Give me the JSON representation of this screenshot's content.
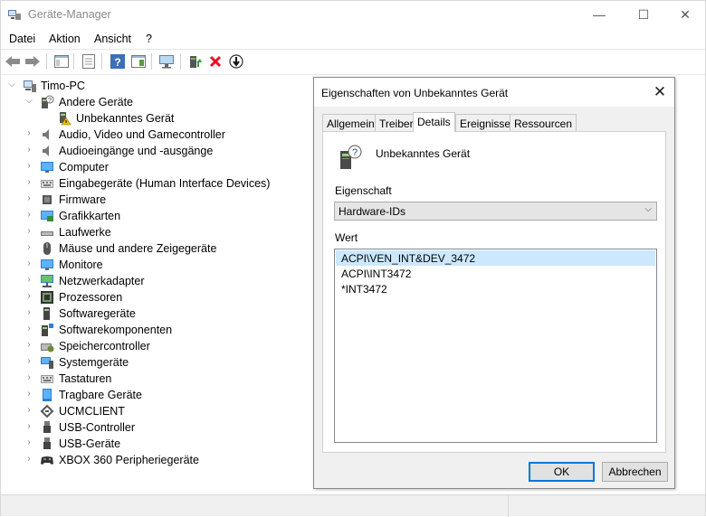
{
  "window": {
    "title": "Geräte-Manager",
    "minimize": "—",
    "maximize": "☐",
    "close": "✕"
  },
  "menu": [
    "Datei",
    "Aktion",
    "Ansicht",
    "?"
  ],
  "toolbar": {
    "icons": [
      "back-arrow-icon",
      "forward-arrow-icon",
      "show-hide-tree-icon",
      "properties-icon",
      "help-icon",
      "action-pane-icon",
      "scan-hardware-icon",
      "update-driver-icon",
      "uninstall-icon",
      "disable-device-icon"
    ],
    "uninstall_color": "#e81123"
  },
  "tree": {
    "root": "Timo-PC",
    "expanded_group": "Andere Geräte",
    "expanded_child": "Unbekanntes Gerät",
    "categories": [
      "Audio, Video und Gamecontroller",
      "Audioeingänge und -ausgänge",
      "Computer",
      "Eingabegeräte (Human Interface Devices)",
      "Firmware",
      "Grafikkarten",
      "Laufwerke",
      "Mäuse und andere Zeigegeräte",
      "Monitore",
      "Netzwerkadapter",
      "Prozessoren",
      "Softwaregeräte",
      "Softwarekomponenten",
      "Speichercontroller",
      "Systemgeräte",
      "Tastaturen",
      "Tragbare Geräte",
      "UCMCLIENT",
      "USB-Controller",
      "USB-Geräte",
      "XBOX 360 Peripheriegeräte"
    ]
  },
  "dialog": {
    "title": "Eigenschaften von Unbekanntes Gerät",
    "close": "✕",
    "tabs": [
      "Allgemein",
      "Treiber",
      "Details",
      "Ereignisse",
      "Ressourcen"
    ],
    "active_tab": "Details",
    "device_name": "Unbekanntes Gerät",
    "property_label": "Eigenschaft",
    "property_value": "Hardware-IDs",
    "value_label": "Wert",
    "values": [
      "ACPI\\VEN_INT&DEV_3472",
      "ACPI\\INT3472",
      "*INT3472"
    ],
    "ok": "OK",
    "cancel": "Abbrechen"
  },
  "colors": {
    "selection": "#cce8ff",
    "accent": "#0078d7",
    "warning": "#f0c000"
  }
}
